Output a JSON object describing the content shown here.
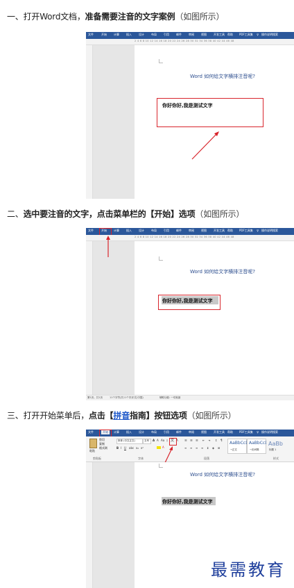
{
  "steps": [
    {
      "prefix": "一、打开Word文档，",
      "bold": "准备需要注音的文字案例",
      "suffix": "（如图所示）"
    },
    {
      "prefix": "二、",
      "bold": "选中要注音的文字，点击菜单栏的【开始】选项",
      "suffix": "（如图所示）"
    },
    {
      "prefix": "三、打开开始菜单后，",
      "bold_a": "点击【",
      "link": "拼音",
      "bold_b": "指南】按钮选项",
      "suffix": "（如图所示）"
    }
  ],
  "word": {
    "tabs": [
      "文件",
      "开始",
      "计算",
      "插入",
      "设计",
      "布局",
      "引用",
      "邮件",
      "审阅",
      "视图",
      "开发工具",
      "帮助",
      "PDF工具集",
      "♀",
      "操作说明搜索"
    ],
    "ruler_numbers": "2  4  6  8  10  12  14  16  18  20  22  24  26  28  30  32  34  36  38  40  42  44  46  48",
    "doc_title": "Word 如何给文字横排注音呢?",
    "doc_text": "你好你好,我是测试文字",
    "status_bar": [
      "第1页，共1页",
      "11个字符(共11个字)",
      "中文(中国)",
      "辅助功能: 一切就绪"
    ],
    "home_ribbon": {
      "clipboard": [
        "剪切",
        "复制",
        "格式刷"
      ],
      "paste_label": "粘贴",
      "font_name": "宋体 (中文正文)",
      "font_size": "五号",
      "groups": [
        "剪贴板",
        "字体",
        "段落",
        "样式"
      ],
      "styles": [
        {
          "preview": "AaBbCcDd",
          "name": "→正文"
        },
        {
          "preview": "AaBbCcD",
          "name": "→无间隔"
        },
        {
          "preview": "AaBb",
          "name": "标题 1"
        }
      ]
    }
  },
  "watermark": "最需教育",
  "colors": {
    "word_blue": "#2b579a",
    "highlight_red": "#d8242b",
    "link_blue": "#1a55c8",
    "watermark": "#1f3f9c"
  }
}
